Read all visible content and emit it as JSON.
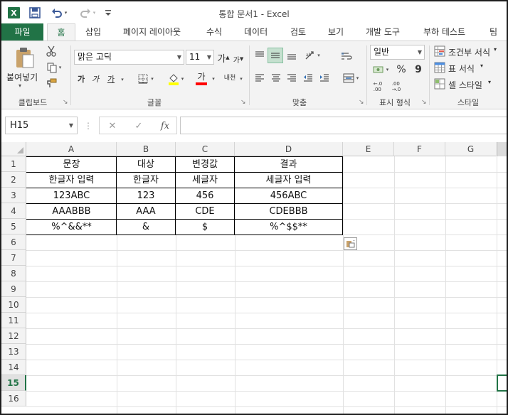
{
  "window": {
    "title": "통합 문서1 - Excel"
  },
  "icons": {
    "app": "excel-logo-icon",
    "save": "save-icon",
    "undo": "undo-icon",
    "redo": "redo-icon",
    "customize": "customize-toolbar-icon"
  },
  "app_logo_letter": "X",
  "tabs": [
    {
      "label": "파일"
    },
    {
      "label": "홈"
    },
    {
      "label": "삽입"
    },
    {
      "label": "페이지 레이아웃"
    },
    {
      "label": "수식"
    },
    {
      "label": "데이터"
    },
    {
      "label": "검토"
    },
    {
      "label": "보기"
    },
    {
      "label": "개발 도구"
    },
    {
      "label": "부하 테스트"
    },
    {
      "label": "팀"
    }
  ],
  "ribbon": {
    "clipboard": {
      "paste_label": "붙여넣기",
      "group_label": "클립보드"
    },
    "font": {
      "name": "맑은 고딕",
      "size": "11",
      "grow": "가",
      "shrink": "가",
      "bold": "가",
      "italic": "가",
      "underline": "가",
      "fontcolor": "가",
      "phonetic": "내천",
      "group_label": "글꼴"
    },
    "alignment": {
      "group_label": "맞춤"
    },
    "number": {
      "format": "일반",
      "percent": "%",
      "comma": "9",
      "inc_decimal": "←.0\n.00",
      "dec_decimal": ".00\n→.0",
      "group_label": "표시 형식"
    },
    "styles": {
      "conditional": "조건부 서식",
      "table": "표 서식",
      "cell": "셀 스타일",
      "group_label": "스타일"
    }
  },
  "formula_bar": {
    "name_box": "H15",
    "cancel": "✕",
    "enter": "✓",
    "fx": "fx",
    "value": ""
  },
  "accent": "#217346",
  "columns": [
    "A",
    "B",
    "C",
    "D",
    "E",
    "F",
    "G"
  ],
  "rows": [
    "1",
    "2",
    "3",
    "4",
    "5",
    "6",
    "7",
    "8",
    "9",
    "10",
    "11",
    "12",
    "13",
    "14",
    "15",
    "16"
  ],
  "selected_cell": "H15",
  "table": [
    [
      "문장",
      "대상",
      "변경값",
      "결과"
    ],
    [
      "한글자 입력",
      "한글자",
      "세글자",
      "세글자 입력"
    ],
    [
      "123ABC",
      "123",
      "456",
      "456ABC"
    ],
    [
      "AAABBB",
      "AAA",
      "CDE",
      "CDEBBB"
    ],
    [
      "%^&&**",
      "&",
      "$",
      "%^$$**"
    ]
  ]
}
